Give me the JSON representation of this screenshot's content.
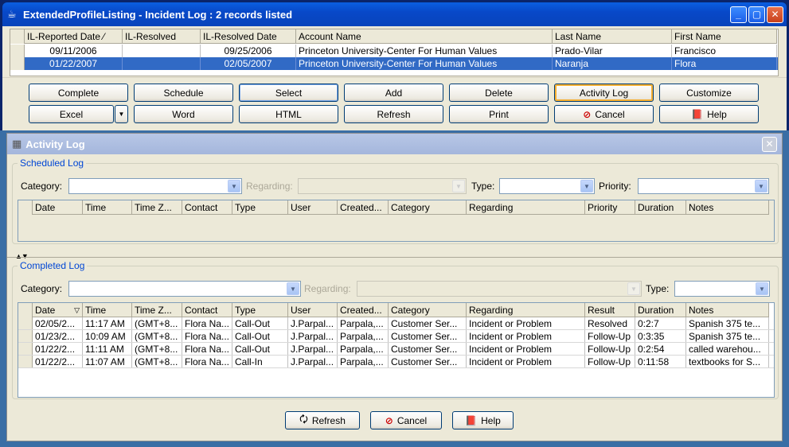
{
  "listing_window": {
    "title": "ExtendedProfileListing - Incident Log : 2 records listed",
    "columns": [
      "IL-Reported Date",
      "IL-Resolved",
      "IL-Resolved Date",
      "Account Name",
      "Last Name",
      "First Name"
    ],
    "sort_indicator": "⁄",
    "rows": [
      {
        "reported": "09/11/2006",
        "resolved": "",
        "resolved_date": "09/25/2006",
        "account": "Princeton University-Center For Human Values",
        "last": "Prado-Vilar",
        "first": "Francisco"
      },
      {
        "reported": "01/22/2007",
        "resolved": "",
        "resolved_date": "02/05/2007",
        "account": "Princeton University-Center For Human Values",
        "last": "Naranja",
        "first": "Flora"
      }
    ],
    "buttons_row1": [
      "Complete",
      "Schedule",
      "Select",
      "Add",
      "Delete",
      "Activity Log",
      "Customize"
    ],
    "buttons_row2": {
      "excel": "Excel",
      "word": "Word",
      "html": "HTML",
      "refresh": "Refresh",
      "print": "Print",
      "cancel": "Cancel",
      "help": "Help"
    }
  },
  "activity_window": {
    "title": "Activity Log",
    "scheduled": {
      "title": "Scheduled Log",
      "labels": {
        "category": "Category:",
        "regarding": "Regarding:",
        "type": "Type:",
        "priority": "Priority:"
      },
      "columns": [
        "Date",
        "Time",
        "Time Z...",
        "Contact",
        "Type",
        "User",
        "Created...",
        "Category",
        "Regarding",
        "Priority",
        "Duration",
        "Notes"
      ]
    },
    "completed": {
      "title": "Completed Log",
      "labels": {
        "category": "Category:",
        "regarding": "Regarding:",
        "type": "Type:"
      },
      "columns": [
        "Date",
        "Time",
        "Time Z...",
        "Contact",
        "Type",
        "User",
        "Created...",
        "Category",
        "Regarding",
        "Result",
        "Duration",
        "Notes"
      ],
      "rows": [
        [
          "02/05/2...",
          "11:17 AM",
          "(GMT+8...",
          "Flora Na...",
          "Call-Out",
          "J.Parpal...",
          "Parpala,...",
          "Customer Ser...",
          "Incident or Problem",
          "Resolved",
          "0:2:7",
          "Spanish 375 te..."
        ],
        [
          "01/23/2...",
          "10:09 AM",
          "(GMT+8...",
          "Flora Na...",
          "Call-Out",
          "J.Parpal...",
          "Parpala,...",
          "Customer Ser...",
          "Incident or Problem",
          "Follow-Up",
          "0:3:35",
          "Spanish 375 te..."
        ],
        [
          "01/22/2...",
          "11:11 AM",
          "(GMT+8...",
          "Flora Na...",
          "Call-Out",
          "J.Parpal...",
          "Parpala,...",
          "Customer Ser...",
          "Incident or Problem",
          "Follow-Up",
          "0:2:54",
          "called warehou..."
        ],
        [
          "01/22/2...",
          "11:07 AM",
          "(GMT+8...",
          "Flora Na...",
          "Call-In",
          "J.Parpal...",
          "Parpala,...",
          "Customer Ser...",
          "Incident or Problem",
          "Follow-Up",
          "0:11:58",
          "textbooks for S..."
        ]
      ]
    },
    "buttons": {
      "refresh": "Refresh",
      "cancel": "Cancel",
      "help": "Help"
    }
  },
  "icons": {
    "window": "java-cup-icon",
    "activity": "checkered-flag-icon",
    "cancel": "no-entry-icon",
    "help": "book-icon",
    "refresh": "refresh-icon"
  }
}
